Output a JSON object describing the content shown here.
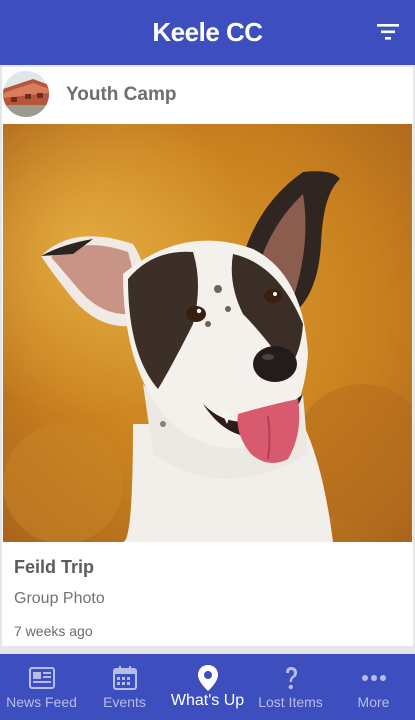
{
  "app_bar": {
    "title_main": "Keele",
    "title_suffix": "CC",
    "filter_icon": "filter-icon"
  },
  "post": {
    "group_name": "Youth Camp",
    "group_avatar_icon": "building-photo",
    "title": "Feild Trip",
    "subtitle": "Group Photo",
    "time": "7 weeks ago"
  },
  "bottom_nav": {
    "items": [
      {
        "label": "News Feed",
        "icon": "newspaper-icon",
        "active": false
      },
      {
        "label": "Events",
        "icon": "calendar-icon",
        "active": false
      },
      {
        "label": "What's Up",
        "icon": "map-pin-icon",
        "active": true
      },
      {
        "label": "Lost Items",
        "icon": "question-icon",
        "active": false
      },
      {
        "label": "More",
        "icon": "more-dots-icon",
        "active": false
      }
    ]
  },
  "colors": {
    "primary": "#3d4fbf",
    "inactive_nav": "#b7bde8",
    "active_nav": "#ffffff"
  }
}
